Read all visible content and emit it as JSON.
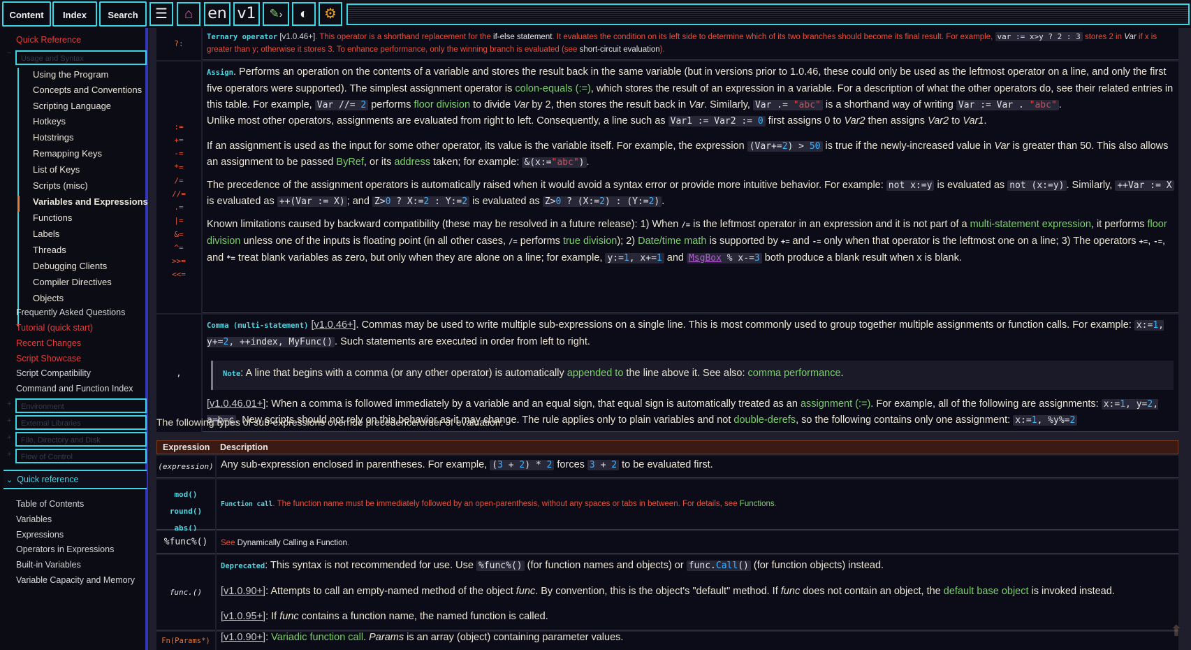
{
  "toolbar": {
    "tabs": [
      "Content",
      "Index",
      "Search"
    ],
    "lang": "en",
    "version": "v1"
  },
  "sidebar": {
    "quick_reference_top": "Quick Reference",
    "usage_and_syntax": "Usage and Syntax",
    "sub_items": [
      "Using the Program",
      "Concepts and Conventions",
      "Scripting Language",
      "Hotkeys",
      "Hotstrings",
      "Remapping Keys",
      "List of Keys",
      "Scripts (misc)",
      "Variables and Expressions",
      "Functions",
      "Labels",
      "Threads",
      "Debugging Clients",
      "Compiler Directives",
      "Objects"
    ],
    "top_items": [
      "Frequently Asked Questions",
      "Tutorial (quick start)",
      "Recent Changes",
      "Script Showcase",
      "Script Compatibility",
      "Command and Function Index"
    ],
    "collapsed_boxes": [
      "Environment",
      "External Libraries",
      "File, Directory and Disk",
      "Flow of Control"
    ],
    "quick_reference_section": "Quick reference",
    "qr_items": [
      "Table of Contents",
      "Variables",
      "Expressions",
      "Operators in Expressions",
      "Built-in Variables",
      "Variable Capacity and Memory"
    ]
  },
  "ternary": {
    "symbol": "?:",
    "label": "Ternary operator",
    "version": "[v1.0.46+]",
    "text1": ". This operator is a shorthand replacement for the ",
    "link1": "if-else statement",
    "text2": ". It evaluates the condition on its left side to determine which of its two branches should become its final result. For example, ",
    "code1": "var := x>y ? 2 : 3",
    "text3": " stores 2 in ",
    "var_word": "Var",
    "text4": " if x is greater than y; otherwise it stores 3. To enhance performance, only the winning branch is evaluated (see ",
    "link2": "short-circuit evaluation",
    "text5": ")."
  },
  "assign": {
    "operators": [
      ":=",
      "+=",
      "-=",
      "*=",
      "/=",
      "//=",
      ".=",
      "|=",
      "&=",
      "^=",
      ">>=",
      "<<="
    ],
    "label": "Assign",
    "p1_a": ". Performs an operation on the contents of a variable and stores the result back in the same variable (but in versions prior to 1.0.46, these could only be used as the leftmost operator on a line, and only the first five operators were supported). The simplest assignment operator is ",
    "p1_link1": "colon-equals (:=)",
    "p1_b": ", which stores the result of an expression in a variable. For a description of what the other operators do, see their related entries in this table. For example, ",
    "p1_code1": "Var //= 2",
    "p1_c": " performs ",
    "p1_link2": "floor division",
    "p1_d": " to divide ",
    "p1_e": " by 2, then stores the result back in ",
    "p1_f": ". Similarly, ",
    "p1_code2": "Var .= \"abc\"",
    "p1_g": " is a shorthand way of writing ",
    "p1_code3": "Var := Var . \"abc\"",
    "p1_h": ".",
    "p2": "Unlike most other operators, assignments are evaluated from right to left. Consequently, a line such as",
    "p2_code": "Var1 := Var2 := 0",
    "p2_b": " first assigns 0 to ",
    "p2_var2": "Var2",
    "p2_c": " then assigns ",
    "p2_d": " to ",
    "p2_var1": "Var1",
    "p2_e": ".",
    "p3_a": "If an assignment is used as the input for some other operator, its value is the variable itself. For example, the expression ",
    "p3_code1": "(Var+=2) > 50",
    "p3_b": " is true if the newly-increased value in ",
    "p3_c": " is greater than 50. This also allows an assignment to be passed ",
    "p3_link1": "ByRef",
    "p3_d": ", or its ",
    "p3_link2": "address",
    "p3_e": " taken; for example: ",
    "p3_code2": "&(x:=\"abc\")",
    "p3_f": ".",
    "p4_a": "The precedence of the assignment operators is automatically raised when it would avoid a syntax error or provide more intuitive behavior. For example: ",
    "p4_code1": "not x:=y",
    "p4_b": " is evaluated as ",
    "p4_code2": "not (x:=y)",
    "p4_c": ". Similarly, ",
    "p4_code3": "++Var := X",
    "p4_d": " is evaluated as ",
    "p4_code4": "++(Var := X)",
    "p4_e": "; and ",
    "p4_code5": "Z>0 ? X:=2 : Y:=2",
    "p4_f": " is evaluated as ",
    "p4_code6": "Z>0 ? (X:=2) : (Y:=2)",
    "p4_g": ".",
    "p5_a": "Known limitations caused by backward compatibility (these may be resolved in a future release): 1) When ",
    "p5_op1": "/=",
    "p5_b": " is the leftmost operator in an expression and it is not part of a ",
    "p5_link1": "multi-statement expression",
    "p5_c": ", it performs ",
    "p5_link2": "floor division",
    "p5_d": " unless one of the inputs is floating point (in all other cases, ",
    "p5_op2": "/=",
    "p5_e": " performs ",
    "p5_link3": "true division",
    "p5_f": "); 2) ",
    "p5_link4": "Date/time math",
    "p5_g": " is supported by ",
    "p5_op3": "+=",
    "p5_h": " and ",
    "p5_op4": "-=",
    "p5_i": " only when that operator is the leftmost one on a line; 3) The operators ",
    "p5_op5": "+=",
    "p5_j": ", ",
    "p5_op6": "-=",
    "p5_k": ", and ",
    "p5_op7": "*=",
    "p5_l": " treat blank variables as zero, but only when they are alone on a line; for example, ",
    "p5_code1": "y:=1, x+=1",
    "p5_m": " and ",
    "p5_code2": "MsgBox % x-=3",
    "p5_n": " both produce a blank result when x is blank."
  },
  "comma": {
    "symbol": ",",
    "label": "Comma (multi-statement)",
    "version": "[v1.0.46+]",
    "p1_a": ". Commas may be used to write multiple sub-expressions on a single line. This is most commonly used to group together multiple assignments or function calls. For example: ",
    "p1_code": "x:=1, y+=2, ++index, MyFunc()",
    "p1_b": ". Such statements are executed in order from left to right.",
    "note_label": "Note",
    "note_a": ": A line that begins with a comma (or any other operator) is automatically ",
    "note_link1": "appended to",
    "note_b": " the line above it. See also: ",
    "note_link2": "comma performance",
    "note_c": ".",
    "p2_version": "[v1.0.46.01+]",
    "p2_a": ": When a comma is followed immediately by a variable and an equal sign, that equal sign is automatically treated as an ",
    "p2_link1": "assignment (:=)",
    "p2_b": ". For example, all of the following are assignments: ",
    "p2_code1": "x:=1, y=2, a=b=c",
    "p2_c": ". New scripts should not rely on this behavior as it may change. The rule applies only to plain variables and not ",
    "p2_link2": "double-derefs",
    "p2_d": ", so the following contains only one assignment: ",
    "p2_code2": "x:=1, %y%=2"
  },
  "override_intro": "The following types of sub-expressions override precedence/order of evaluation:",
  "table2": {
    "headers": [
      "Expression",
      "Description"
    ],
    "rows": [
      {
        "expr": "(expression)",
        "desc_a": "Any sub-expression enclosed in parentheses. For example, ",
        "code1": "(3 + 2) * 2",
        "desc_b": " forces ",
        "code2": "3 + 2",
        "desc_c": " to be evaluated first."
      },
      {
        "expr_lines": [
          "mod()",
          "round()",
          "abs()"
        ],
        "label": "Function call",
        "desc": ". The function name must be immediately followed by an open-parenthesis, without any spaces or tabs in between. For details, see ",
        "link": "Functions",
        "desc_end": "."
      },
      {
        "expr": "%func%()",
        "desc_a": "See ",
        "link": "Dynamically Calling a Function",
        "desc_b": "."
      },
      {
        "expr": "func.()",
        "deprecated_label": "Deprecated",
        "dep_a": ": This syntax is not recommended for use. Use ",
        "dep_code1": "%func%()",
        "dep_b": " (for function names and objects) or ",
        "dep_code2": "func.Call()",
        "dep_c": " (for function objects) instead.",
        "v1_version": "[v1.0.90+]",
        "v1_a": ": Attempts to call an empty-named method of the object ",
        "v1_func": "func",
        "v1_b": ". By convention, this is the object's \"default\" method. If ",
        "v1_c": " does not contain an object, the ",
        "v1_link": "default base object",
        "v1_d": " is invoked instead.",
        "v2_version": "[v1.0.95+]",
        "v2_a": ": If ",
        "v2_b": " contains a function name, the named function is called."
      },
      {
        "expr": "Fn(Params*)",
        "version": "[v1.0.90+]",
        "link": "Variadic function call",
        "desc_a": ". ",
        "params_word": "Params",
        "desc_b": " is an array (object) containing parameter values."
      }
    ]
  }
}
